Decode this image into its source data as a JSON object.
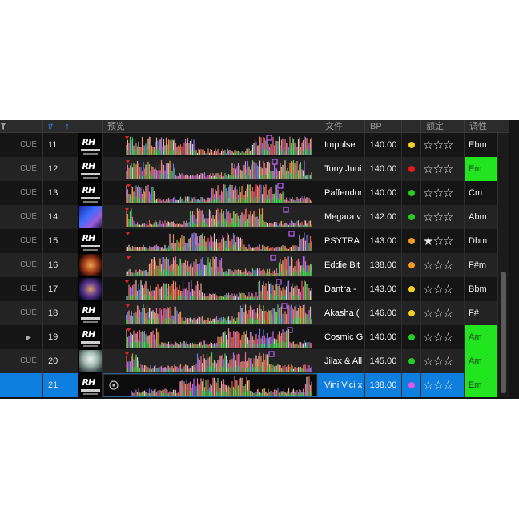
{
  "header": {
    "num": "#",
    "sort_arrow": "↑",
    "preview": "预览",
    "title": "文件",
    "bpm": "BP",
    "rating": "额定",
    "key": "调性"
  },
  "colors": {
    "selected_row": "#0e7fdf",
    "key_highlight": "#21e61f"
  },
  "rows": [
    {
      "cue": "CUE",
      "num": "11",
      "art": "rh-logo",
      "title": "Impulse",
      "bpm": "140.00",
      "color": "#f5d01e",
      "stars": "☆☆☆",
      "key": "Ebm",
      "key_highlight": false
    },
    {
      "cue": "CUE",
      "num": "12",
      "art": "rh-logo",
      "title": "Tony Juni",
      "bpm": "140.00",
      "color": "#e81a1a",
      "stars": "☆☆☆",
      "key": "Em",
      "key_highlight": true
    },
    {
      "cue": "CUE",
      "num": "13",
      "art": "rh-logo",
      "title": "Paffendor",
      "bpm": "140.00",
      "color": "#22d11e",
      "stars": "☆☆☆",
      "key": "Cm",
      "key_highlight": false
    },
    {
      "cue": "CUE",
      "num": "14",
      "art": "blue-cover",
      "title": "Megara v",
      "bpm": "142.00",
      "color": "#22d11e",
      "stars": "☆☆☆",
      "key": "Abm",
      "key_highlight": false
    },
    {
      "cue": "CUE",
      "num": "15",
      "art": "rh-logo",
      "title": "PSYTRA",
      "bpm": "143.00",
      "color": "#f59a1e",
      "stars": "★☆☆",
      "key": "Dbm",
      "key_highlight": false
    },
    {
      "cue": "CUE",
      "num": "16",
      "art": "orange-cover",
      "title": "Eddie Bit",
      "bpm": "138.00",
      "color": "#f59a1e",
      "stars": "☆☆☆",
      "key": "F#m",
      "key_highlight": false
    },
    {
      "cue": "CUE",
      "num": "17",
      "art": "purple-cover",
      "title": "Dantra -",
      "bpm": "143.00",
      "color": "#f5d01e",
      "stars": "☆☆☆",
      "key": "Bbm",
      "key_highlight": false
    },
    {
      "cue": "CUE",
      "num": "18",
      "art": "rh-logo",
      "title": "Akasha (",
      "bpm": "146.00",
      "color": "#f5d01e",
      "stars": "☆☆☆",
      "key": "F#",
      "key_highlight": false
    },
    {
      "cue": "▶",
      "num": "19",
      "art": "rh-logo",
      "title": "Cosmic G",
      "bpm": "140.00",
      "color": "#22d11e",
      "stars": "☆☆☆",
      "key": "Am",
      "key_highlight": true
    },
    {
      "cue": "CUE",
      "num": "20",
      "art": "white-cover",
      "title": "Jilax & All",
      "bpm": "145.00",
      "color": "#22d11e",
      "stars": "☆☆☆",
      "key": "Am",
      "key_highlight": true
    },
    {
      "cue": "",
      "num": "21",
      "art": "rh-logo",
      "title": "Vini Vici x",
      "bpm": "138.00",
      "color": "#e455e8",
      "stars": "☆☆☆",
      "key": "Em",
      "key_highlight": true,
      "selected": true
    }
  ],
  "logo_text": "RH"
}
